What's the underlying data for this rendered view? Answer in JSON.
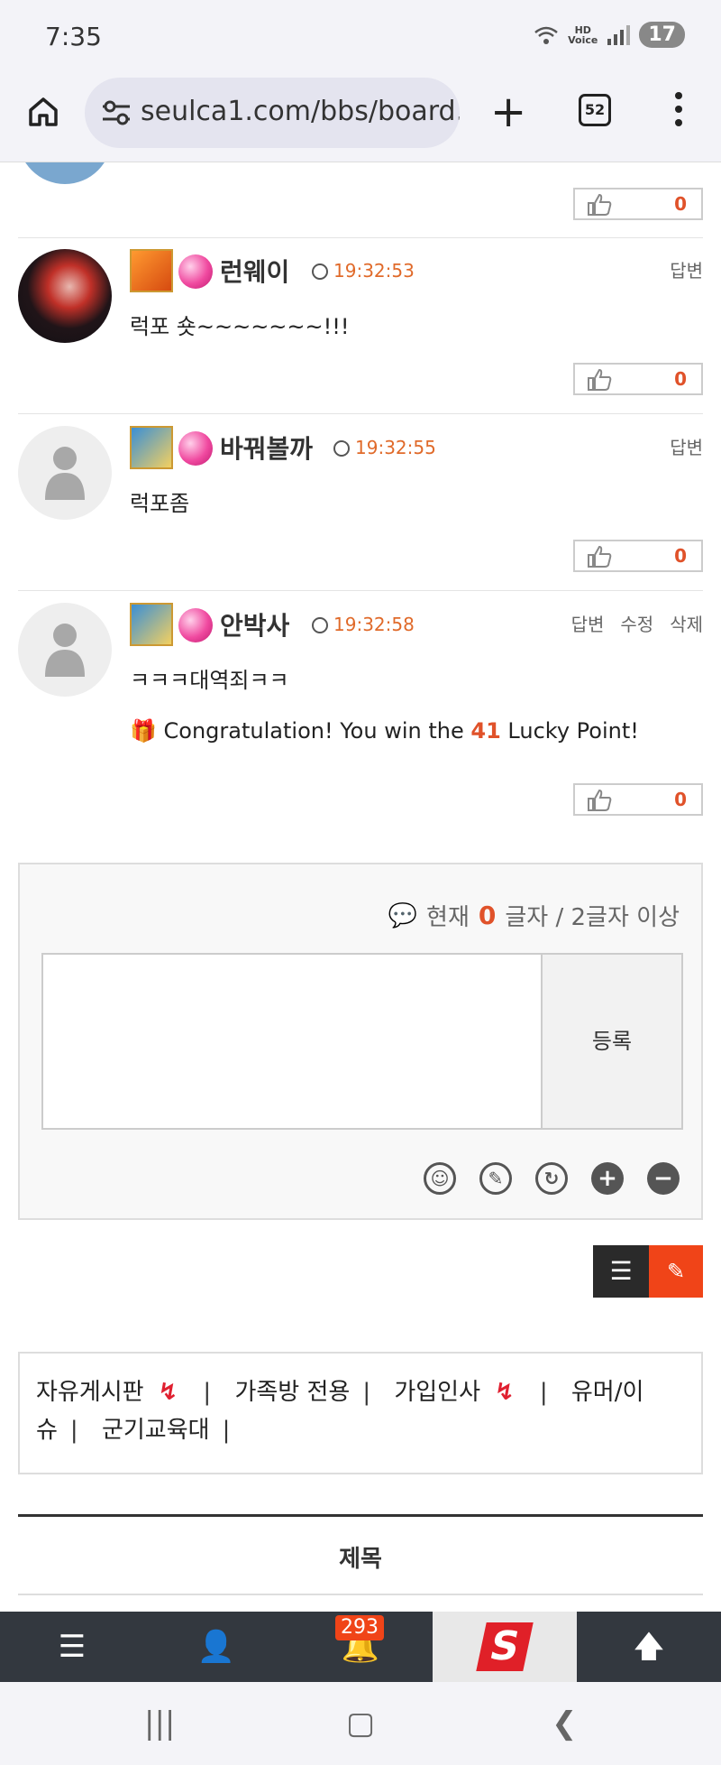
{
  "status": {
    "time": "7:35",
    "hd": "HD",
    "voice": "Voice",
    "battery": "17"
  },
  "browser": {
    "url": "seulca1.com/bbs/board.p",
    "tabs_count": "52"
  },
  "comments": [
    {
      "nick": "런웨이",
      "time": "19:32:53",
      "body": "럭포 숏~~~~~~~!!!",
      "actions": [
        "답변"
      ],
      "likes": "0"
    },
    {
      "nick": "바꿔볼까",
      "time": "19:32:55",
      "body": "럭포좀",
      "actions": [
        "답변"
      ],
      "likes": "0"
    },
    {
      "nick": "안박사",
      "time": "19:32:58",
      "body": "ㅋㅋㅋ대역죄ㅋㅋ",
      "actions": [
        "답변",
        "수정",
        "삭제"
      ],
      "likes": "0",
      "lucky": {
        "pre": "Congratulation! You win the",
        "points": "41",
        "post": "Lucky Point!"
      }
    }
  ],
  "prev_comment": {
    "likes": "0"
  },
  "reply": {
    "counter_pre": "현재",
    "counter_count": "0",
    "counter_post": "글자 / 2글자 이상",
    "submit": "등록"
  },
  "categories": [
    "자유게시판",
    "가족방 전용",
    "가입인사",
    "유머/이슈",
    "군기교육대"
  ],
  "table_header": "제목",
  "bottom_nav": {
    "notifications": "293"
  }
}
